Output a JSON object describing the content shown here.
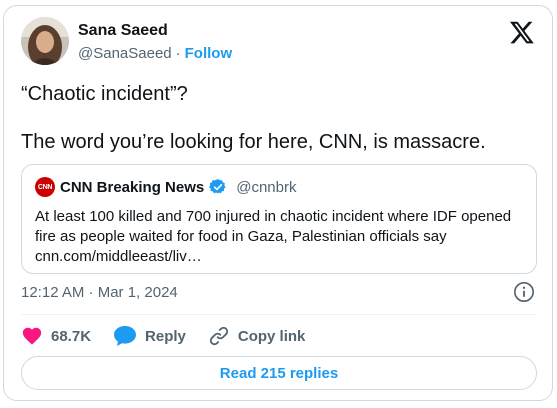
{
  "author": {
    "name": "Sana Saeed",
    "handle": "@SanaSaeed",
    "separator": "·",
    "follow_label": "Follow"
  },
  "tweet": {
    "text": "“Chaotic incident”?\n\nThe word you’re looking for here, CNN, is massacre.",
    "timestamp": "12:12 AM · Mar 1, 2024"
  },
  "quoted_tweet": {
    "logo_text": "CNN",
    "author_name": "CNN Breaking News",
    "handle": "@cnnbrk",
    "text": "At least 100 killed and 700 injured in chaotic incident where IDF opened fire as people waited for food in Gaza, Palestinian officials say cnn.com/middleeast/liv…"
  },
  "actions": {
    "like_count": "68.7K",
    "reply_label": "Reply",
    "copy_link_label": "Copy link"
  },
  "read_replies_label": "Read 215 replies",
  "icons": {
    "x_logo": "x-logo-icon",
    "info": "info-icon",
    "heart": "heart-icon",
    "reply": "reply-bubble-icon",
    "link": "link-icon",
    "verified": "verified-badge-icon"
  },
  "colors": {
    "accent": "#1d9bf0",
    "like": "#f91880",
    "text": "#0f1419",
    "secondary": "#536471",
    "border": "#cfd9de"
  }
}
